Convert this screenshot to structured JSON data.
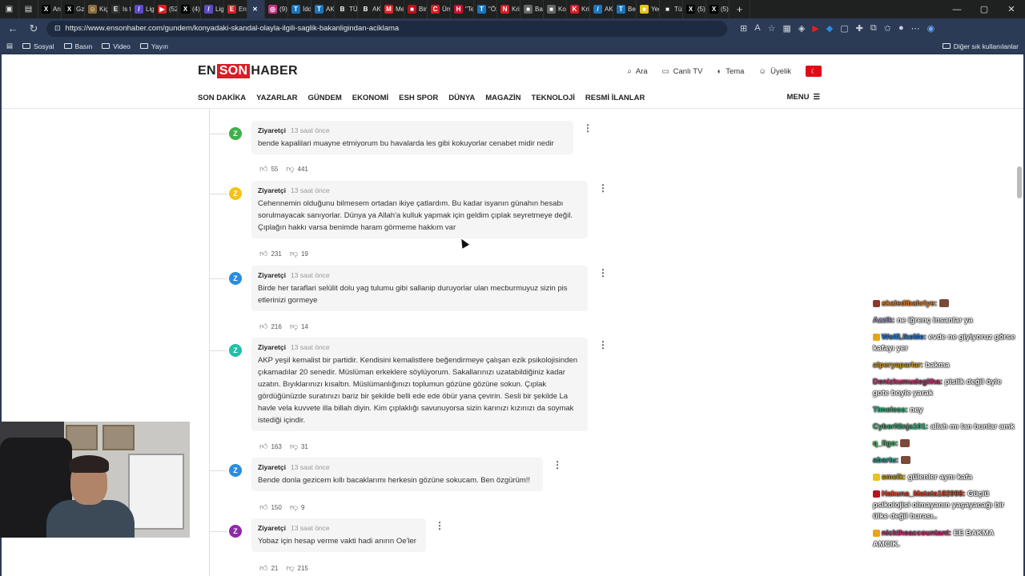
{
  "browser": {
    "tabs": [
      {
        "fav": "X",
        "color": "#000000",
        "label": "Ana"
      },
      {
        "fav": "X",
        "color": "#000000",
        "label": "GzT"
      },
      {
        "fav": "☺",
        "color": "#8a6d3b",
        "label": "Kiçi"
      },
      {
        "fav": "E",
        "color": "#333333",
        "label": "Is tı"
      },
      {
        "fav": "/",
        "color": "#5b4bc4",
        "label": "Ligi"
      },
      {
        "fav": "▶",
        "color": "#e02020",
        "label": "(52"
      },
      {
        "fav": "X",
        "color": "#000000",
        "label": "(4)"
      },
      {
        "fav": "/",
        "color": "#5b4bc4",
        "label": "Ligi"
      },
      {
        "fav": "E",
        "color": "#d61f26",
        "label": "En"
      },
      {
        "fav": "✕",
        "color": "#ffffff",
        "label": ""
      },
      {
        "fav": "◎",
        "color": "#c13584",
        "label": "(9)"
      },
      {
        "fav": "T",
        "color": "#1b75bb",
        "label": "İddi"
      },
      {
        "fav": "T",
        "color": "#1b75bb",
        "label": "AKP"
      },
      {
        "fav": "B",
        "color": "#222222",
        "label": "TÜC"
      },
      {
        "fav": "B",
        "color": "#222222",
        "label": "AKP"
      },
      {
        "fav": "M",
        "color": "#e02020",
        "label": "Me"
      },
      {
        "fav": "■",
        "color": "#b7141b",
        "label": "Bini"
      },
      {
        "fav": "C",
        "color": "#d61f26",
        "label": "Üm"
      },
      {
        "fav": "H",
        "color": "#c8102e",
        "label": "\"Te"
      },
      {
        "fav": "T",
        "color": "#1b75bb",
        "label": "\"Öz"
      },
      {
        "fav": "N",
        "color": "#d61f26",
        "label": "Kriz"
      },
      {
        "fav": "■",
        "color": "#666666",
        "label": "Bah"
      },
      {
        "fav": "■",
        "color": "#666666",
        "label": "Kon"
      },
      {
        "fav": "K",
        "color": "#d61f26",
        "label": "Kriz"
      },
      {
        "fav": "/",
        "color": "#1b75bb",
        "label": "AK"
      },
      {
        "fav": "T",
        "color": "#1b75bb",
        "label": "Beş"
      },
      {
        "fav": "■",
        "color": "#e8c31a",
        "label": "Yed"
      },
      {
        "fav": "■",
        "color": "#222222",
        "label": "Tür"
      },
      {
        "fav": "X",
        "color": "#000000",
        "label": "(5)"
      },
      {
        "fav": "X",
        "color": "#000000",
        "label": "(5)"
      }
    ],
    "url": "https://www.ensonhaber.com/gundem/konyadaki-skandal-olayla-ilgili-saglik-bakanligindan-aciklama",
    "bookmarks": [
      "Sosyal",
      "Basın",
      "Video",
      "Yayın"
    ],
    "other_bookmarks": "Diğer sık kullanılanlar"
  },
  "site": {
    "logo_en": "EN",
    "logo_son": "SON",
    "logo_haber": "HABER",
    "tools": [
      {
        "icon": "search-icon",
        "glyph": "⌕",
        "label": "Ara"
      },
      {
        "icon": "tv-icon",
        "glyph": "▭",
        "label": "Canlı TV"
      },
      {
        "icon": "theme-icon",
        "glyph": "◐",
        "label": "Tema"
      },
      {
        "icon": "user-icon",
        "glyph": "☺",
        "label": "Üyelik"
      }
    ],
    "nav": [
      "SON DAKİKA",
      "YAZARLAR",
      "GÜNDEM",
      "EKONOMİ",
      "ESH SPOR",
      "DÜNYA",
      "MAGAZİN",
      "TEKNOLOJİ",
      "RESMİ İLANLAR"
    ],
    "menu": "MENU"
  },
  "comments": [
    {
      "avatar": "Z",
      "color": "#3fb049",
      "author": "Ziyaretçi",
      "time": "13 saat önce",
      "text": "bende kapalilari muayne etmiyorum bu havalarda les gibi kokuyorlar cenabet midir nedir",
      "likes": "55",
      "dislikes": "441"
    },
    {
      "avatar": "Z",
      "color": "#f2c417",
      "author": "Ziyaretçi",
      "time": "13 saat önce",
      "text": "Cehennemin olduğunu bilmesem ortadan ikiye çatlardım. Bu kadar isyanın günahın hesabı sorulmayacak sanıyorlar. Dünya ya Allah'a kulluk yapmak için geldim çıplak seyretmeye değil. Çıplağın hakkı varsa benimde haram görmeme hakkım var",
      "likes": "231",
      "dislikes": "19"
    },
    {
      "avatar": "Z",
      "color": "#2a8be0",
      "author": "Ziyaretçi",
      "time": "13 saat önce",
      "text": "Birde her taraflari selülit dolu yag tulumu gibi sallanip duruyorlar ulan mecburmuyuz sizin pis etlerinizi gormeye",
      "likes": "216",
      "dislikes": "14"
    },
    {
      "avatar": "Z",
      "color": "#1fbfa8",
      "author": "Ziyaretçi",
      "time": "13 saat önce",
      "text": "AKP yeşil kemalist bir partidir. Kendisini kemalistlere beğendirmeye çalışan ezik psikolojisinden çıkamadılar 20 senedir. Müslüman erkeklere söylüyorum. Sakallarınızı uzatabildiğiniz kadar uzatın. Bıyıklarınızı kısaltın. Müslümanlığınızı toplumun gözüne gözüne sokun. Çıplak gördüğünüzde suratınızı bariz bir şekilde belli ede ede öbür yana çevirin. Sesli bir şekilde La havle vela kuvvete illa billah diyin. Kim çıplaklığı savunuyorsa sizin karınızı kızınızı da soymak istediği içindir.",
      "likes": "163",
      "dislikes": "31"
    },
    {
      "avatar": "Z",
      "color": "#2a8be0",
      "author": "Ziyaretçi",
      "time": "13 saat önce",
      "text": "Bende donla gezicem kıllı bacaklarımı herkesin gözüne sokucam. Ben özgürüm!!",
      "likes": "150",
      "dislikes": "9"
    },
    {
      "avatar": "Z",
      "color": "#8e2aa8",
      "author": "Ziyaretçi",
      "time": "13 saat önce",
      "text": "Yobaz için hesap verme vakti hadi anırın Oe'ler",
      "likes": "21",
      "dislikes": "215"
    }
  ],
  "chat": [
    {
      "user": "skaledibahriye:",
      "ucolor": "#e07a1f",
      "text": "",
      "badge": "#8a3a2a",
      "emote": true
    },
    {
      "user": "Azzik:",
      "ucolor": "#9b8fbf",
      "text": "ne iğrenç insanlar ya"
    },
    {
      "user": "WolfLikeMe:",
      "ucolor": "#2a7ad0",
      "text": "evde ne giyiyoruz görse kafayı yer",
      "badge": "#e8a317"
    },
    {
      "user": "alperyaparlar:",
      "ucolor": "#c79a2a",
      "text": "bakma"
    },
    {
      "user": "Denizkumudegliha:",
      "ucolor": "#c0306a",
      "text": "pislik değil öyle gote boyle yarak"
    },
    {
      "user": "Timeless:",
      "ucolor": "#2ab07a",
      "text": "ney"
    },
    {
      "user": "CyberNinja101:",
      "ucolor": "#3aa070",
      "text": "allah mı lan bunlar amk"
    },
    {
      "user": "q_figo:",
      "ucolor": "#40b05a",
      "text": "",
      "emote": true
    },
    {
      "user": "abartu:",
      "ucolor": "#2a9a8a",
      "text": "",
      "emote": true
    },
    {
      "user": "smelk:",
      "ucolor": "#c9a21a",
      "text": "gülenler aynı kafa",
      "badge": "#e8c31a"
    },
    {
      "user": "Hakuna_Matata182998:",
      "ucolor": "#e0402a",
      "text": "Güçlü psikolojisi olmayanın yaşayacağı bir ülke değil burası..",
      "badge": "#b7141b"
    },
    {
      "user": "nicktheaccountant:",
      "ucolor": "#c02a6a",
      "text": "EE BAKMA AMCIK.",
      "badge": "#e8a317"
    }
  ]
}
